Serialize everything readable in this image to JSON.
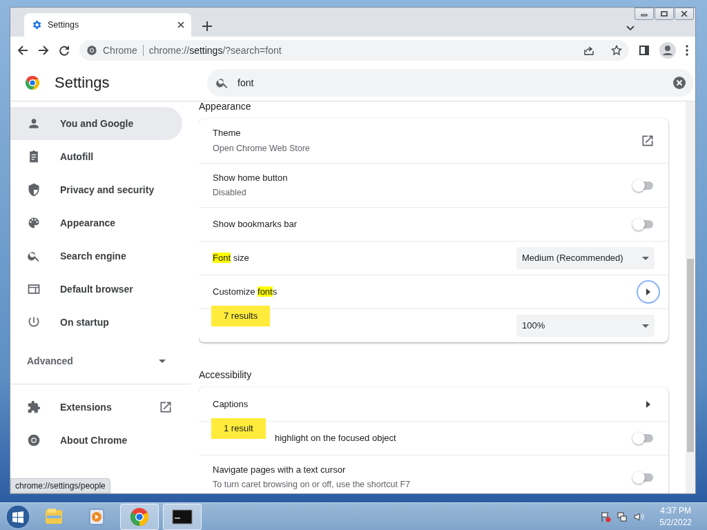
{
  "tabs": [
    {
      "title": "Settings",
      "selected": true
    }
  ],
  "address_bar": {
    "site_label": "Chrome",
    "url_scheme": "chrome://",
    "url_host": "settings",
    "url_rest": "/?search=font"
  },
  "header": {
    "title": "Settings"
  },
  "search": {
    "value": "font"
  },
  "sidebar": {
    "items": [
      {
        "label": "You and Google",
        "selected": true
      },
      {
        "label": "Autofill",
        "selected": false
      },
      {
        "label": "Privacy and security",
        "selected": false
      },
      {
        "label": "Appearance",
        "selected": false
      },
      {
        "label": "Search engine",
        "selected": false
      },
      {
        "label": "Default browser",
        "selected": false
      },
      {
        "label": "On startup",
        "selected": false
      }
    ],
    "advanced": {
      "label": "Advanced",
      "expanded": false
    },
    "footer_items": [
      {
        "label": "Extensions",
        "external": true
      },
      {
        "label": "About Chrome",
        "external": false
      }
    ]
  },
  "status_url": "chrome://settings/people",
  "sections": [
    {
      "title": "Appearance",
      "rows": [
        {
          "kind": "link",
          "label": [
            {
              "text": "Theme",
              "highlighted": false
            }
          ],
          "sublabel": "Open Chrome Web Store"
        },
        {
          "kind": "toggle",
          "label": [
            {
              "text": "Show home button",
              "highlighted": false
            }
          ],
          "sublabel": "Disabled",
          "on": false
        },
        {
          "kind": "toggle",
          "label": [
            {
              "text": "Show bookmarks bar",
              "highlighted": false
            }
          ],
          "on": false
        },
        {
          "kind": "select",
          "label": [
            {
              "text": "Font",
              "highlighted": true
            },
            {
              "text": " size",
              "highlighted": false
            }
          ],
          "value": "Medium (Recommended)"
        },
        {
          "kind": "arrow",
          "label": [
            {
              "text": "Customize ",
              "highlighted": false
            },
            {
              "text": "font",
              "highlighted": true
            },
            {
              "text": "s",
              "highlighted": false
            }
          ],
          "focused": true,
          "bubble": "7 results"
        },
        {
          "kind": "select",
          "label": [],
          "value": "100%"
        }
      ]
    },
    {
      "title": "Accessibility",
      "rows": [
        {
          "kind": "arrow",
          "label": [
            {
              "text": "Captions",
              "highlighted": false
            }
          ],
          "focused": false,
          "bubble": "1 result"
        },
        {
          "kind": "toggle",
          "label": [
            {
              "text": "highlight on the focused object",
              "highlighted": false
            }
          ],
          "on": false
        },
        {
          "kind": "toggle",
          "label": [
            {
              "text": "Navigate pages with a text cursor",
              "highlighted": false
            }
          ],
          "sublabel": "To turn caret browsing on or off, use the shortcut F7",
          "on": false
        }
      ]
    }
  ],
  "taskbar": {
    "apps": [
      {
        "running": false
      },
      {
        "running": false
      },
      {
        "running": true
      },
      {
        "running": true
      }
    ],
    "time": "4:37 PM",
    "date": "5/2/2022"
  }
}
